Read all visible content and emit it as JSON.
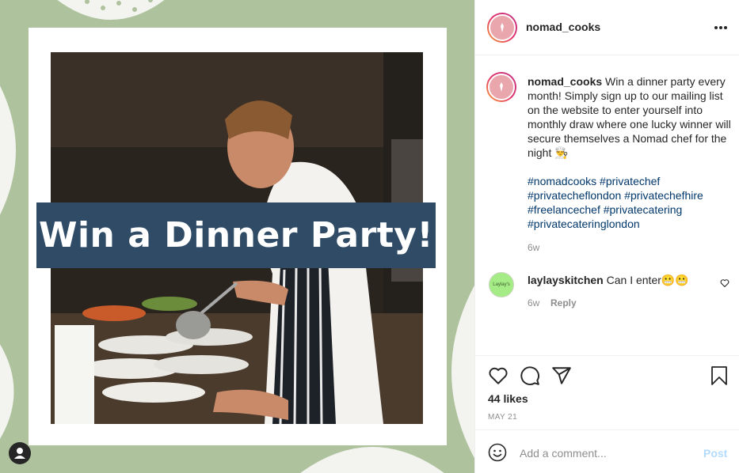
{
  "post": {
    "banner_text": "Win a Dinner Party!",
    "username": "nomad_cooks"
  },
  "caption": {
    "username": "nomad_cooks",
    "text": " Win a dinner party every month! Simply sign up to our mailing list on the website to enter yourself into monthly draw where one lucky winner will secure themselves a Nomad chef for the night 👨‍🍳",
    "hashtags": "#nomadcooks #privatechef #privatecheflondon #privatechefhire #freelancechef #privatecatering #privatecateringlondon",
    "time": "6w"
  },
  "comments": [
    {
      "username": "laylayskitchen",
      "text": " Can I enter😬😬",
      "time": "6w",
      "reply_label": "Reply",
      "avatar_text": "Laylay's"
    }
  ],
  "stats": {
    "likes": "44 likes",
    "date": "MAY 21"
  },
  "comment_box": {
    "placeholder": "Add a comment...",
    "post_label": "Post"
  },
  "icons": [
    "more-options-icon",
    "heart-icon",
    "comment-icon",
    "share-icon",
    "bookmark-icon",
    "emoji-icon",
    "user-tag-icon"
  ],
  "colors": {
    "background_green": "#aec39d",
    "banner": "#2f4b66",
    "hashtag": "#00376b",
    "post_button": "#b3dbff"
  }
}
